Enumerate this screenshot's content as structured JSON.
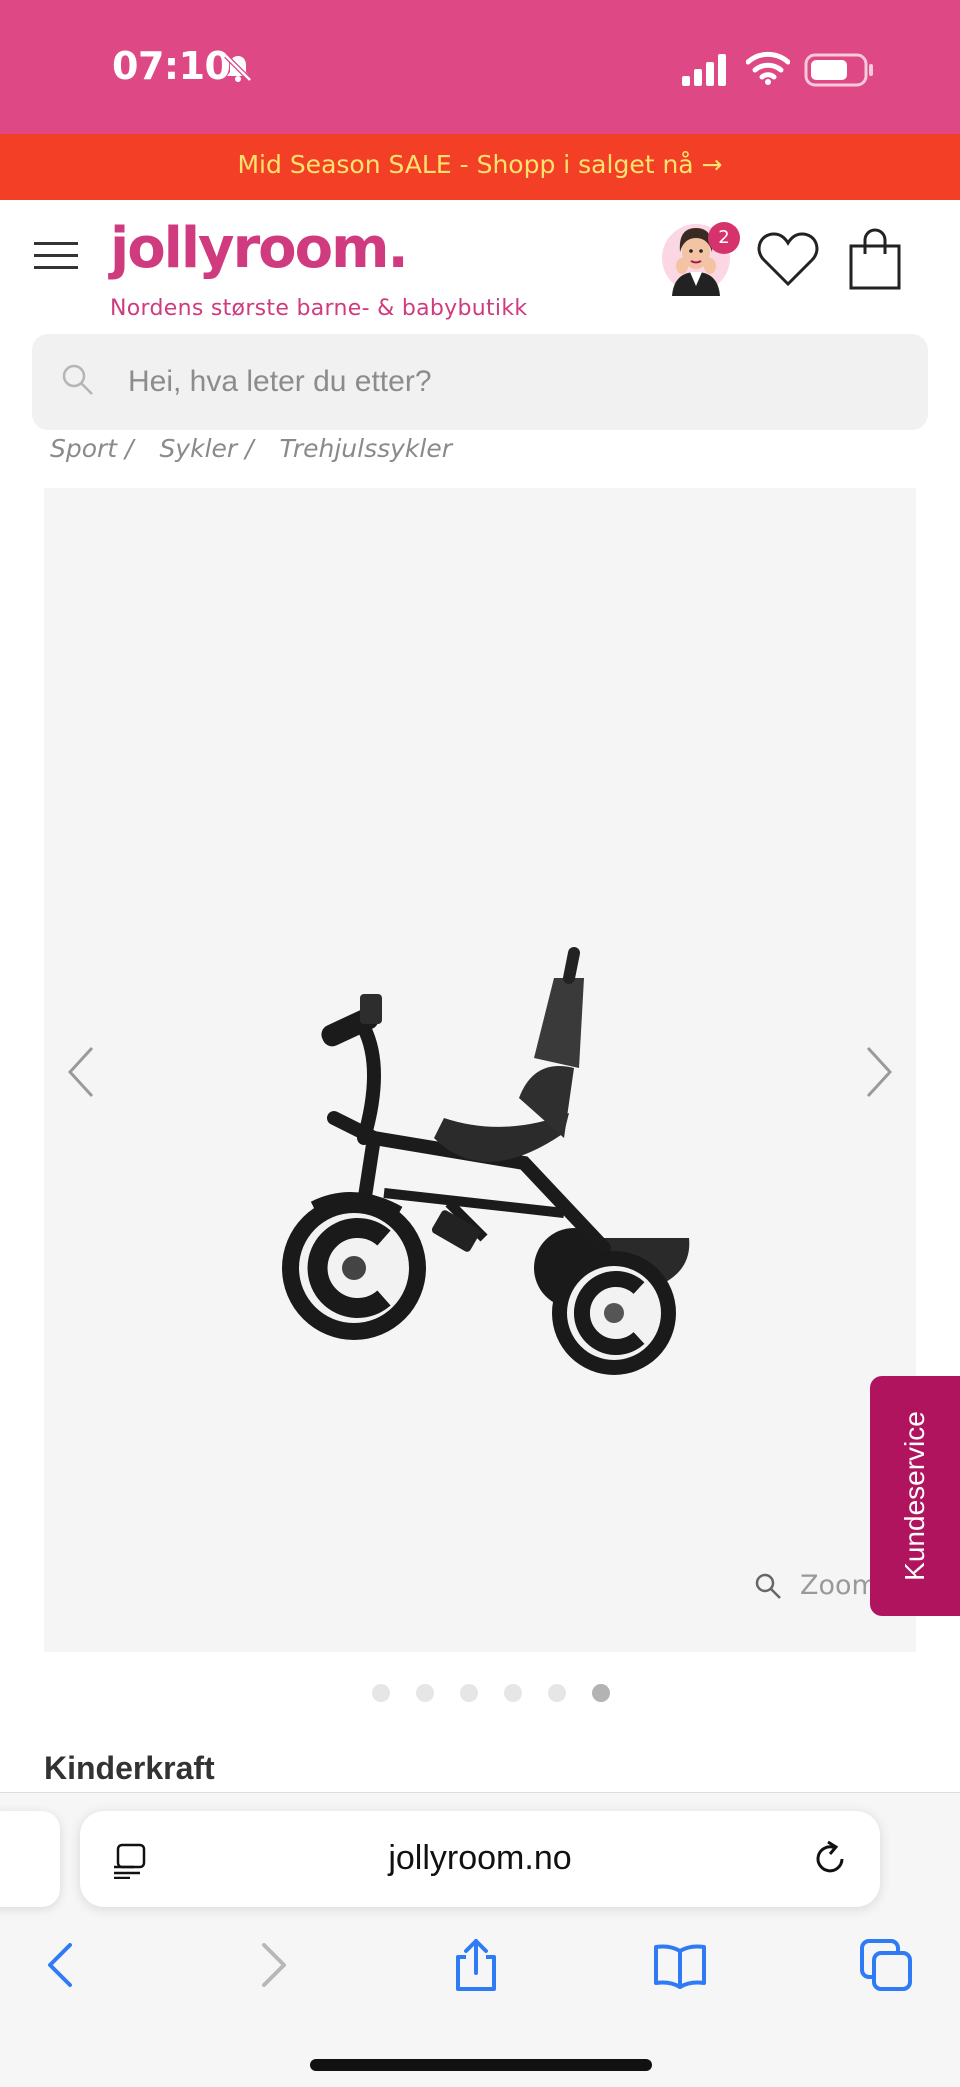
{
  "status_bar": {
    "time": "07:10"
  },
  "promo": {
    "text": "Mid Season SALE - Shopp i salget nå →"
  },
  "header": {
    "logo": "jollyroom.",
    "tagline": "Nordens største barne- & babybutikk",
    "avatar_badge": "2"
  },
  "search": {
    "placeholder": "Hei, hva leter du etter?"
  },
  "breadcrumb": [
    "Sport /",
    "Sykler /",
    "Trehjulssykler"
  ],
  "gallery": {
    "zoom_label": "Zoom",
    "dot_count": 6,
    "active_dot": 5
  },
  "kundeservice": {
    "label": "Kundeservice"
  },
  "product": {
    "brand": "Kinderkraft"
  },
  "browser": {
    "url": "jollyroom.no"
  },
  "colors": {
    "brand_pink": "#de4885",
    "promo_red": "#f33f26",
    "promo_text": "#ffe36e",
    "cta_plum": "#b0145e",
    "ios_blue": "#2f7bf5"
  }
}
